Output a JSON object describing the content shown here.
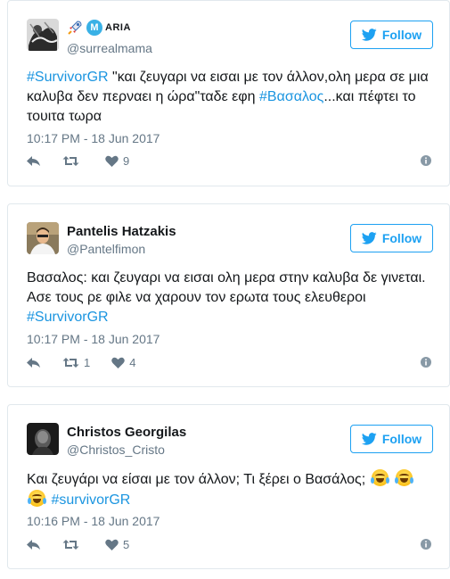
{
  "tweets": [
    {
      "display_name": "ARIA",
      "badge_letter": "M",
      "handle": "@surrealmama",
      "follow_label": "Follow",
      "text": {
        "h1": "#SurvivorGR",
        "t1": " \"και ζευγαρι να εισαι με τον άλλον,ολη μερα σε μια καλυβα δεν περναει η ώρα\"ταδε εφη ",
        "h2": "#Βασαλος",
        "t2": "...και πέφτει το τουιτα τωρα"
      },
      "timestamp": "10:17 PM - 18 Jun 2017",
      "retweets": "",
      "likes": "9"
    },
    {
      "display_name": "Pantelis Hatzakis",
      "handle": "@Pantelfimon",
      "follow_label": "Follow",
      "text": {
        "t1": "Βασαλος: και ζευγαρι να εισαι ολη μερα στην καλυβα δε γινεται. Ασε τους ρε φιλε να χαρουν τον ερωτα τους ελευθεροι ",
        "h1": "#SurvivorGR"
      },
      "timestamp": "10:17 PM - 18 Jun 2017",
      "retweets": "1",
      "likes": "4"
    },
    {
      "display_name": "Christos Georgilas",
      "handle": "@Christos_Cristo",
      "follow_label": "Follow",
      "text": {
        "t1": "Και ζευγάρι να είσαι με τον άλλον; Τι ξέρει ο Βασάλος; ",
        "h1": "#survivorGR"
      },
      "timestamp": "10:16 PM - 18 Jun 2017",
      "retweets": "",
      "likes": "5"
    }
  ],
  "icons": {
    "reply": "reply-icon",
    "retweet": "retweet-icon",
    "like": "heart-icon",
    "info": "info-icon",
    "follow": "twitter-bird-icon",
    "emoji": "tears-of-joy-emoji"
  },
  "colors": {
    "accent": "#1da1f2",
    "hashtag": "#1b95e0",
    "secondary_text": "#657786",
    "border": "#e1e8ed"
  }
}
